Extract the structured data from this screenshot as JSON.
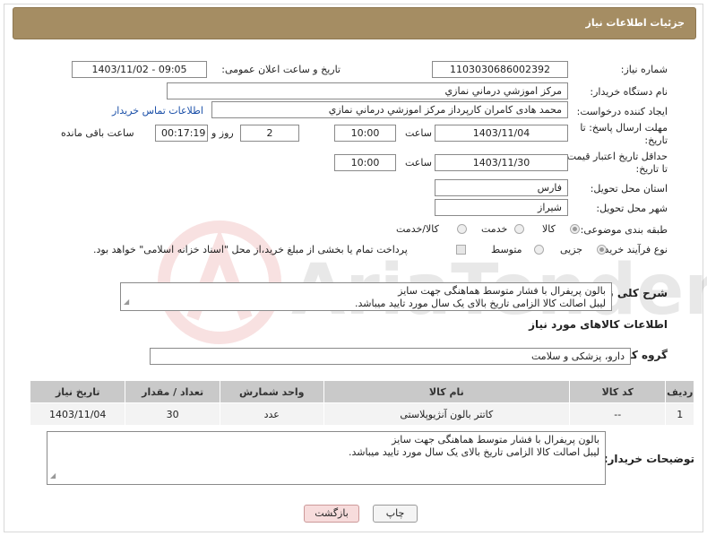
{
  "header": {
    "title": "جزئیات اطلاعات نیاز"
  },
  "form": {
    "need_number_label": "شماره نیاز:",
    "need_number": "1103030686002392",
    "announce_label": "تاریخ و ساعت اعلان عمومی:",
    "announce_value": "1403/11/02 - 09:05",
    "buyer_org_label": "نام دستگاه خریدار:",
    "buyer_org": "مرکز اموزشي درماني نمازي",
    "creator_label": "ایجاد کننده درخواست:",
    "creator": "محمد هادی کامران کارپرداز مرکز اموزشي درماني نمازي",
    "contact_link": "اطلاعات تماس خریدار",
    "deadline_label": "مهلت ارسال پاسخ: تا تاریخ:",
    "deadline_date": "1403/11/04",
    "time_label": "ساعت",
    "deadline_time": "10:00",
    "days_value": "2",
    "days_label": "روز و",
    "remaining_time": "00:17:19",
    "remaining_label": "ساعت باقی مانده",
    "min_validity_label": "حداقل تاریخ اعتبار قیمت: تا تاریخ:",
    "validity_date": "1403/11/30",
    "validity_time": "10:00",
    "province_label": "استان محل تحویل:",
    "province": "فارس",
    "city_label": "شهر محل تحویل:",
    "city": "شیراز",
    "category_label": "طبقه بندی موضوعی:",
    "category_options": [
      "کالا",
      "خدمت",
      "کالا/خدمت"
    ],
    "process_label": "نوع فرآیند خرید :",
    "process_options": [
      "جزیی",
      "متوسط"
    ],
    "payment_note": "پرداخت تمام یا بخشی از مبلغ خرید،از محل \"اسناد خزانه اسلامی\" خواهد بود.",
    "summary_label": "شرح کلی نیاز:",
    "summary_line1": "بالون پریفرال با فشار متوسط هماهنگی جهت سایز",
    "summary_line2": "لیبل اصالت کالا الزامی  تاریخ بالای یک سال مورد تایید میباشد."
  },
  "goods": {
    "section_title": "اطلاعات کالاهای مورد نیاز",
    "group_label": "گروه کالا:",
    "group_value": "دارو، پزشکی و سلامت",
    "columns": [
      "ردیف",
      "کد کالا",
      "نام کالا",
      "واحد شمارش",
      "تعداد / مقدار",
      "تاریخ نیاز"
    ],
    "rows": [
      [
        "1",
        "--",
        "کاتتر بالون آنژیوپلاستی",
        "عدد",
        "30",
        "1403/11/04"
      ]
    ]
  },
  "buyer_notes": {
    "label": "توضیحات خریدار:",
    "line1": "بالون پریفرال با فشار متوسط هماهنگی جهت سایز",
    "line2": "لیبل اصالت کالا الزامی  تاریخ بالای یک سال مورد تایید میباشد."
  },
  "buttons": {
    "print": "چاپ",
    "back": "بازگشت"
  },
  "watermark": {
    "text": "AriaTender.neT"
  },
  "colors": {
    "header_bg": "#a58d63",
    "link": "#1a4fa8",
    "back_bg": "#f7dcdc",
    "print_bg": "#f4f4f4"
  }
}
